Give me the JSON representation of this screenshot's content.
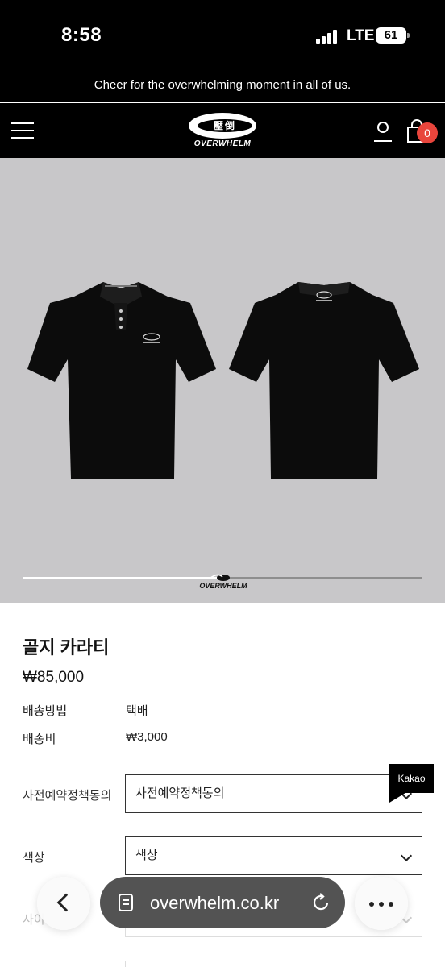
{
  "status_bar": {
    "time": "8:58",
    "network": "LTE",
    "battery": "61"
  },
  "banner": {
    "text": "Cheer for the overwhelming moment in all of us."
  },
  "header": {
    "logo_mark": "壓倒",
    "logo_text": "OVERWHELM",
    "cart_count": "0",
    "icons": [
      "menu-icon",
      "user-icon",
      "cart-icon"
    ]
  },
  "gallery": {
    "watermark": "OVERWHELM",
    "progress": 0.5
  },
  "product": {
    "name": "골지 카라티",
    "price": "₩85,000",
    "info": [
      {
        "label": "배송방법",
        "value": "택배"
      },
      {
        "label": "배송비",
        "value": "₩3,000"
      }
    ]
  },
  "options": [
    {
      "label": "사전예약정책동의",
      "placeholder": "사전예약정책동의"
    },
    {
      "label": "색상",
      "placeholder": "색상"
    },
    {
      "label": "사이",
      "placeholder": ""
    }
  ],
  "kakao": {
    "label": "Kakao"
  },
  "browser": {
    "url": "overwhelm.co.kr"
  },
  "colors": {
    "background": "#000000",
    "badge": "#e8453c",
    "gallery_bg": "#c8c7c9"
  }
}
